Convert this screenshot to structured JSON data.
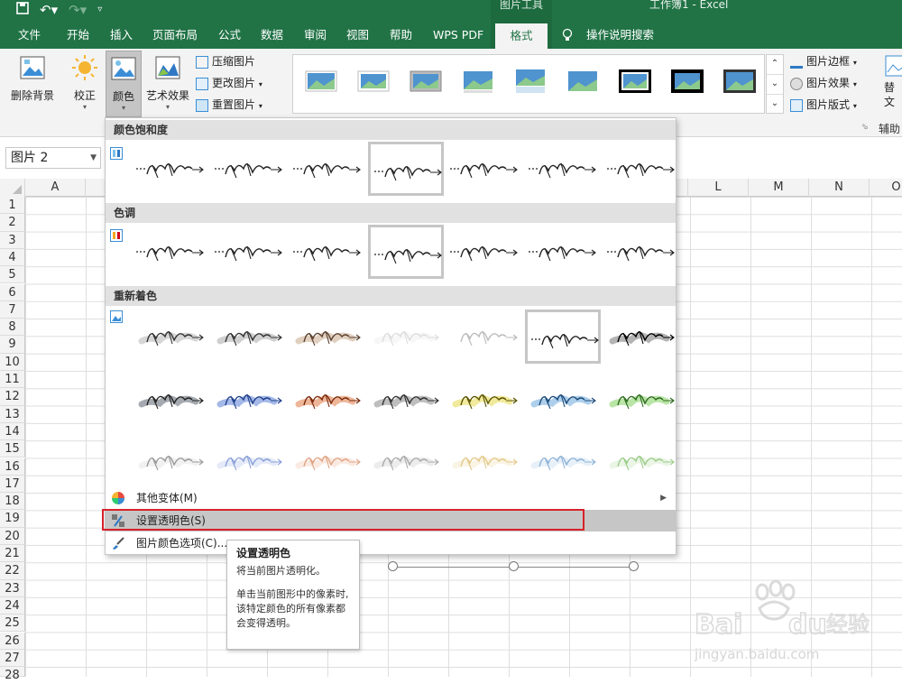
{
  "titlebar": {
    "context_tools_label": "图片工具",
    "window_title": "工作簿1 - Excel"
  },
  "tabs": [
    {
      "label": "文件"
    },
    {
      "label": "开始"
    },
    {
      "label": "插入"
    },
    {
      "label": "页面布局"
    },
    {
      "label": "公式"
    },
    {
      "label": "数据"
    },
    {
      "label": "审阅"
    },
    {
      "label": "视图"
    },
    {
      "label": "帮助"
    },
    {
      "label": "WPS PDF"
    },
    {
      "label": "格式"
    }
  ],
  "tell_me": "操作说明搜索",
  "ribbon": {
    "remove_bg": "删除背景",
    "corrections": "校正",
    "color": "颜色",
    "artistic": "艺术效果",
    "compress": "压缩图片",
    "change_picture": "更改图片",
    "reset_picture": "重置图片",
    "picture_border": "图片边框",
    "picture_effects": "图片效果",
    "picture_layout": "图片版式",
    "alt_text_partial": "替\n文",
    "accessibility_partial": "辅助"
  },
  "namebox": {
    "value": "图片 2"
  },
  "columns": [
    "A",
    "L",
    "M",
    "N",
    "O"
  ],
  "rows": [
    "1",
    "2",
    "3",
    "4",
    "5",
    "6",
    "7",
    "8",
    "9",
    "10",
    "11",
    "12",
    "13",
    "14",
    "15",
    "16",
    "17",
    "18",
    "19",
    "20",
    "21",
    "22",
    "23",
    "24",
    "25",
    "26",
    "27",
    "28"
  ],
  "menu": {
    "saturation_header": "颜色饱和度",
    "tone_header": "色调",
    "recolor_header": "重新着色",
    "more_variations": "其他变体(M)",
    "set_transparent": "设置透明色(S)",
    "color_options": "图片颜色选项(C)..."
  },
  "tooltip": {
    "title": "设置透明色",
    "line1": "将当前图片透明化。",
    "line2": "单击当前图形中的像素时, 该特定颜色的所有像素都会变得透明。"
  },
  "watermark": {
    "brand": "Baidu经验",
    "url": "jingyan.baidu.com"
  },
  "colors": {
    "excel_green": "#217346",
    "highlight": "#c6c6c6",
    "red_box": "#d8222a"
  }
}
